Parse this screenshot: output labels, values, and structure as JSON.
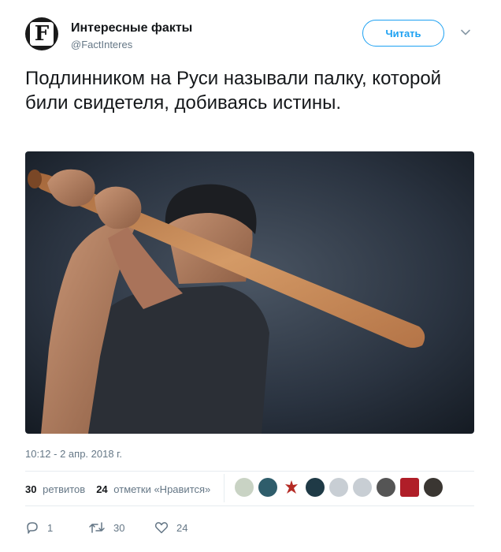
{
  "account": {
    "avatar_letter": "F",
    "name": "Интересные факты",
    "handle": "@FactInteres",
    "follow_label": "Читать"
  },
  "tweet": {
    "text": "Подлинником на Руси называли палку, которой били свидетеля, добиваясь истины.",
    "timestamp": "10:12 - 2 апр. 2018 г."
  },
  "stats": {
    "retweets_count": "30",
    "retweets_label": "ретвитов",
    "likes_count": "24",
    "likes_label": "отметки «Нравится»"
  },
  "likers": [
    {
      "icon": "liker-avatar-1",
      "color": "#c9d3c4"
    },
    {
      "icon": "liker-avatar-2",
      "color": "#2f5d6b"
    },
    {
      "icon": "liker-avatar-3",
      "color": "#b52a24"
    },
    {
      "icon": "liker-avatar-4",
      "color": "#1f3a46"
    },
    {
      "icon": "liker-avatar-5",
      "color": "#c8ced4"
    },
    {
      "icon": "liker-avatar-6",
      "color": "#c8ced4"
    },
    {
      "icon": "liker-avatar-7",
      "color": "#555555"
    },
    {
      "icon": "liker-avatar-8",
      "color": "#b01e28"
    },
    {
      "icon": "liker-avatar-9",
      "color": "#3a3632"
    }
  ],
  "actions": {
    "reply_count": "1",
    "retweet_count": "30",
    "like_count": "24"
  },
  "colors": {
    "accent": "#1da1f2",
    "secondary_text": "#657786",
    "divider": "#e6ecf0"
  }
}
